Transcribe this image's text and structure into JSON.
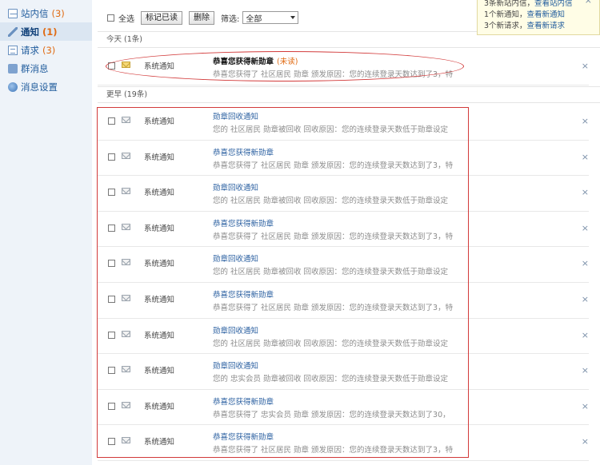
{
  "sidebar": {
    "items": [
      {
        "label": "站内信",
        "count": "(3)",
        "icon": "mail-icon",
        "active": false
      },
      {
        "label": "通知",
        "count": "(1)",
        "icon": "pen-icon",
        "active": true
      },
      {
        "label": "请求",
        "count": "(3)",
        "icon": "document-icon",
        "active": false
      },
      {
        "label": "群消息",
        "count": "",
        "icon": "chat-icon",
        "active": false
      },
      {
        "label": "消息设置",
        "count": "",
        "icon": "globe-icon",
        "active": false
      }
    ]
  },
  "toolbar": {
    "select_all_label": "全选",
    "mark_read_label": "标记已读",
    "delete_label": "删除",
    "filter_label": "筛选:",
    "filter_value": "全部"
  },
  "popup": {
    "line1_text": "3条新站内信，",
    "line1_link": "查看站内信",
    "line2_text": "1个新通知，",
    "line2_link": "查看新通知",
    "line3_text": "3个新请求，",
    "line3_link": "查看新请求",
    "close": "×"
  },
  "today": {
    "header": "今天 (1条)",
    "items": [
      {
        "type": "系统通知",
        "title": "恭喜您获得新勋章",
        "tag": "(未读)",
        "desc": "恭喜您获得了 社区居民 勋章 颁发原因：您的连续登录天数达到了3，特",
        "unread": true
      }
    ]
  },
  "earlier": {
    "header": "更早 (19条)",
    "items": [
      {
        "type": "系统通知",
        "title": "勋章回收通知",
        "desc": "您的 社区居民 勋章被回收 回收原因：您的连续登录天数低于勋章设定"
      },
      {
        "type": "系统通知",
        "title": "恭喜您获得新勋章",
        "desc": "恭喜您获得了 社区居民 勋章 颁发原因：您的连续登录天数达到了3，特"
      },
      {
        "type": "系统通知",
        "title": "勋章回收通知",
        "desc": "您的 社区居民 勋章被回收 回收原因：您的连续登录天数低于勋章设定"
      },
      {
        "type": "系统通知",
        "title": "恭喜您获得新勋章",
        "desc": "恭喜您获得了 社区居民 勋章 颁发原因：您的连续登录天数达到了3，特"
      },
      {
        "type": "系统通知",
        "title": "勋章回收通知",
        "desc": "您的 社区居民 勋章被回收 回收原因：您的连续登录天数低于勋章设定"
      },
      {
        "type": "系统通知",
        "title": "恭喜您获得新勋章",
        "desc": "恭喜您获得了 社区居民 勋章 颁发原因：您的连续登录天数达到了3，特"
      },
      {
        "type": "系统通知",
        "title": "勋章回收通知",
        "desc": "您的 社区居民 勋章被回收 回收原因：您的连续登录天数低于勋章设定"
      },
      {
        "type": "系统通知",
        "title": "勋章回收通知",
        "desc": "您的 忠实会员 勋章被回收 回收原因：您的连续登录天数低于勋章设定"
      },
      {
        "type": "系统通知",
        "title": "恭喜您获得新勋章",
        "desc": "恭喜您获得了 忠实会员 勋章 颁发原因：您的连续登录天数达到了30，"
      },
      {
        "type": "系统通知",
        "title": "恭喜您获得新勋章",
        "desc": "恭喜您获得了 社区居民 勋章 颁发原因：您的连续登录天数达到了3，特"
      }
    ]
  },
  "row_close": "×"
}
